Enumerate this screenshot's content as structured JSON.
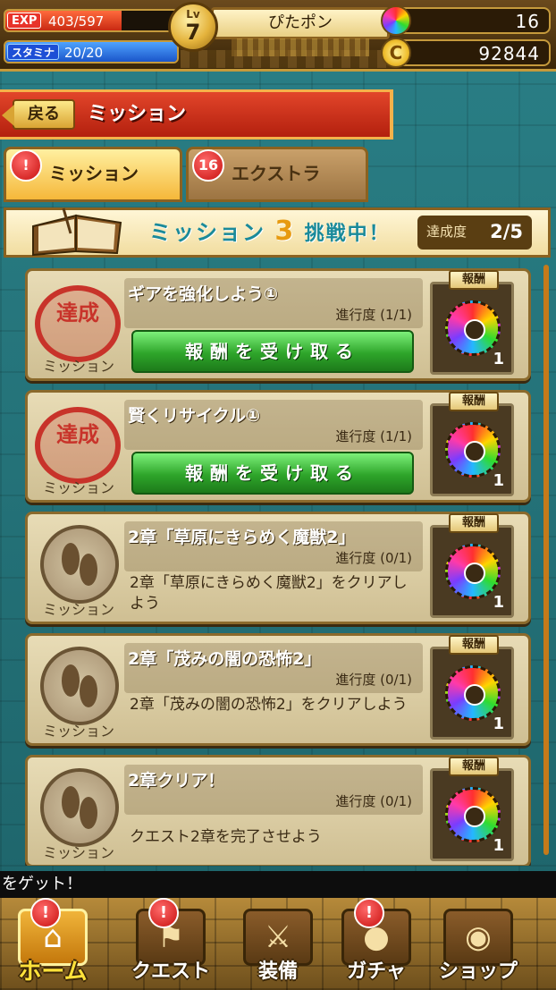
{
  "player": {
    "exp_tag": "EXP",
    "exp_text": "403/597",
    "exp_fraction": 0.675,
    "stamina_tag": "スタミナ",
    "stamina_text": "20/20",
    "stamina_fraction": 1.0,
    "level_label": "Lv",
    "level": "7",
    "name": "ぴたポン",
    "gems": "16",
    "coins": "92844",
    "coin_symbol": "C"
  },
  "header": {
    "back_label": "戻る",
    "title": "ミッション"
  },
  "tabs": [
    {
      "label": "ミッション",
      "badge": "!",
      "active": true
    },
    {
      "label": "エクストラ",
      "badge": "16",
      "active": false
    }
  ],
  "banner": {
    "title_prefix": "ミッション",
    "mission_number": "3",
    "title_suffix": "挑戦中！",
    "progress_label": "達成度",
    "progress_value": "2/5"
  },
  "missions": [
    {
      "title": "ギアを強化しよう①",
      "progress": "進行度 (1/1)",
      "completed": true,
      "stamp_text": "達成",
      "emblem_label": "ミッション",
      "claim_label": "報酬を受け取る",
      "reward_label": "報酬",
      "reward_icon": "rainbow-gear-icon",
      "reward_count": "1"
    },
    {
      "title": "賢くリサイクル①",
      "progress": "進行度 (1/1)",
      "completed": true,
      "stamp_text": "達成",
      "emblem_label": "ミッション",
      "claim_label": "報酬を受け取る",
      "reward_label": "報酬",
      "reward_icon": "rainbow-gear-icon",
      "reward_count": "1"
    },
    {
      "title": "2章「草原にきらめく魔獣2」",
      "progress": "進行度 (0/1)",
      "completed": false,
      "description": "2章「草原にきらめく魔獣2」をクリアしよう",
      "emblem_label": "ミッション",
      "reward_label": "報酬",
      "reward_icon": "rainbow-gear-icon",
      "reward_count": "1"
    },
    {
      "title": "2章「茂みの闇の恐怖2」",
      "progress": "進行度 (0/1)",
      "completed": false,
      "description": "2章「茂みの闇の恐怖2」をクリアしよう",
      "emblem_label": "ミッション",
      "reward_label": "報酬",
      "reward_icon": "rainbow-gear-icon",
      "reward_count": "1"
    },
    {
      "title": "2章クリア！",
      "progress": "進行度 (0/1)",
      "completed": false,
      "description": "クエスト2章を完了させよう",
      "emblem_label": "ミッション",
      "reward_label": "報酬",
      "reward_icon": "rainbow-gear-icon",
      "reward_count": "1"
    }
  ],
  "ticker": "をゲット！",
  "nav": [
    {
      "label": "ホーム",
      "icon": "home-icon",
      "alert": "!",
      "active": true
    },
    {
      "label": "クエスト",
      "icon": "quest-icon",
      "alert": "!",
      "active": false
    },
    {
      "label": "装備",
      "icon": "equipment-icon",
      "alert": "",
      "active": false
    },
    {
      "label": "ガチャ",
      "icon": "gacha-icon",
      "alert": "!",
      "active": false
    },
    {
      "label": "ショップ",
      "icon": "shop-icon",
      "alert": "",
      "active": false
    }
  ]
}
